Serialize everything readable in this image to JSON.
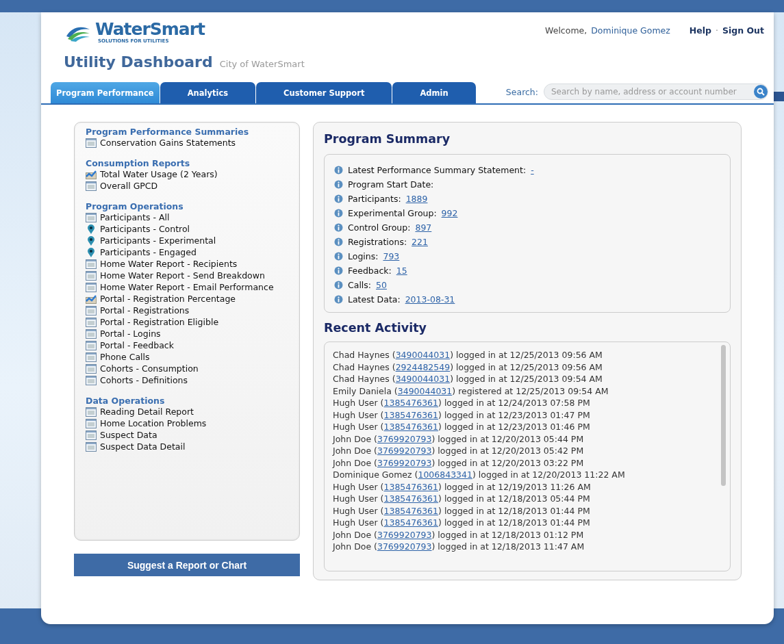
{
  "header": {
    "logo": {
      "name": "WaterSmart",
      "tagline": "SOLUTIONS FOR UTILITIES"
    },
    "welcome": "Welcome,",
    "user": "Dominique Gomez",
    "links": [
      "Help",
      "·",
      "Sign Out"
    ],
    "title": "Utility Dashboard",
    "subtitle": "City of WaterSmart"
  },
  "tabs": [
    {
      "label": "Program Performance",
      "selected": true
    },
    {
      "label": "Analytics",
      "selected": false
    },
    {
      "label": "Customer Support",
      "selected": false
    },
    {
      "label": "Admin",
      "selected": false
    }
  ],
  "search": {
    "label": "Search:",
    "placeholder": "Search by name, address or account number"
  },
  "sidebar": {
    "sections": [
      {
        "title": "Program Performance Summaries",
        "items": [
          {
            "label": "Conservation Gains Statements",
            "kind": "report"
          }
        ]
      },
      {
        "title": "Consumption Reports",
        "items": [
          {
            "label": "Total Water Usage (2 Years)",
            "kind": "chart"
          },
          {
            "label": "Overall GPCD",
            "kind": "report"
          }
        ]
      },
      {
        "title": "Program Operations",
        "items": [
          {
            "label": "Participants - All",
            "kind": "report"
          },
          {
            "label": "Participants - Control",
            "kind": "pin"
          },
          {
            "label": "Participants - Experimental",
            "kind": "pin"
          },
          {
            "label": "Participants - Engaged",
            "kind": "pin"
          },
          {
            "label": "Home Water Report - Recipients",
            "kind": "report"
          },
          {
            "label": "Home Water Report - Send Breakdown",
            "kind": "report"
          },
          {
            "label": "Home Water Report - Email Performance",
            "kind": "report"
          },
          {
            "label": "Portal - Registration Percentage",
            "kind": "chart"
          },
          {
            "label": "Portal - Registrations",
            "kind": "report"
          },
          {
            "label": "Portal - Registration Eligible",
            "kind": "report"
          },
          {
            "label": "Portal - Logins",
            "kind": "report"
          },
          {
            "label": "Portal - Feedback",
            "kind": "report"
          },
          {
            "label": "Phone Calls",
            "kind": "report"
          },
          {
            "label": "Cohorts - Consumption",
            "kind": "report"
          },
          {
            "label": "Cohorts - Definitions",
            "kind": "report"
          }
        ]
      },
      {
        "title": "Data Operations",
        "items": [
          {
            "label": "Reading Detail Report",
            "kind": "report"
          },
          {
            "label": "Home Location Problems",
            "kind": "report"
          },
          {
            "label": "Suspect Data",
            "kind": "report"
          },
          {
            "label": "Suspect Data Detail",
            "kind": "report"
          }
        ]
      }
    ],
    "button": "Suggest a Report or Chart"
  },
  "summary": {
    "title": "Program Summary",
    "items": [
      {
        "label": "Latest Performance Summary Statement:",
        "value": "-"
      },
      {
        "label": "Program Start Date:"
      },
      {
        "label": "Participants:",
        "value": "1889"
      },
      {
        "label": "Experimental Group:",
        "value": "992"
      },
      {
        "label": "Control Group:",
        "value": "897"
      },
      {
        "label": "Registrations:",
        "value": "221"
      },
      {
        "label": "Logins:",
        "value": "793"
      },
      {
        "label": "Feedback:",
        "value": "15"
      },
      {
        "label": "Calls:",
        "value": "50"
      },
      {
        "label": "Latest Data:",
        "value": "2013-08-31"
      }
    ]
  },
  "activity": {
    "title": "Recent Activity",
    "rows": [
      {
        "prefix": "Chad Haynes (",
        "account": "3490044031",
        "suffix": ") logged in at 12/25/2013 09:56 AM"
      },
      {
        "prefix": "Chad Haynes (",
        "account": "2924482549",
        "suffix": ") logged in at 12/25/2013 09:56 AM"
      },
      {
        "prefix": "Chad Haynes (",
        "account": "3490044031",
        "suffix": ") logged in at 12/25/2013 09:54 AM"
      },
      {
        "prefix": "Emily Daniela (",
        "account": "3490044031",
        "suffix": ") registered at 12/25/2013 09:54 AM"
      },
      {
        "prefix": "Hugh User (",
        "account": "1385476361",
        "suffix": ") logged in at 12/24/2013 07:58 PM"
      },
      {
        "prefix": "Hugh User (",
        "account": "1385476361",
        "suffix": ") logged in at 12/23/2013 01:47 PM"
      },
      {
        "prefix": "Hugh User (",
        "account": "1385476361",
        "suffix": ") logged in at 12/23/2013 01:46 PM"
      },
      {
        "prefix": "John Doe (",
        "account": "3769920793",
        "suffix": ") logged in at 12/20/2013 05:44 PM"
      },
      {
        "prefix": "John Doe (",
        "account": "3769920793",
        "suffix": ") logged in at 12/20/2013 05:42 PM"
      },
      {
        "prefix": "John Doe (",
        "account": "3769920793",
        "suffix": ") logged in at 12/20/2013 03:22 PM"
      },
      {
        "prefix": "Dominique Gomez (",
        "account": "1006843341",
        "suffix": ") logged in at 12/20/2013 11:22 AM"
      },
      {
        "prefix": "Hugh User (",
        "account": "1385476361",
        "suffix": ") logged in at 12/19/2013 11:26 AM"
      },
      {
        "prefix": "Hugh User (",
        "account": "1385476361",
        "suffix": ") logged in at 12/18/2013 05:44 PM"
      },
      {
        "prefix": "Hugh User (",
        "account": "1385476361",
        "suffix": ") logged in at 12/18/2013 01:44 PM"
      },
      {
        "prefix": "Hugh User (",
        "account": "1385476361",
        "suffix": ") logged in at 12/18/2013 01:44 PM"
      },
      {
        "prefix": "John Doe (",
        "account": "3769920793",
        "suffix": ") logged in at 12/18/2013 01:12 PM"
      },
      {
        "prefix": "John Doe (",
        "account": "3769920793",
        "suffix": ") logged in at 12/18/2013 11:47 AM"
      }
    ]
  }
}
